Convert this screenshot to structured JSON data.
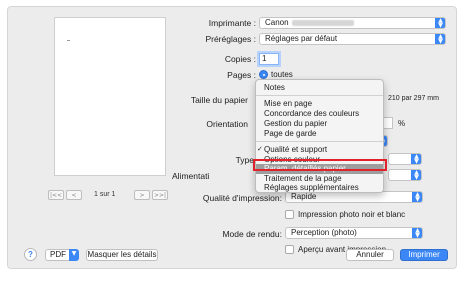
{
  "printer": {
    "label": "Imprimante :",
    "value": "Canon"
  },
  "presets": {
    "label": "Préréglages :",
    "value": "Réglages par défaut"
  },
  "copies": {
    "label": "Copies :",
    "value": "1"
  },
  "pages": {
    "label": "Pages :",
    "value": "toutes"
  },
  "paper_size": {
    "label": "Taille du papier",
    "dimensions": "210 par 297 mm"
  },
  "orientation": {
    "label": "Orientation",
    "percent": "%"
  },
  "type": {
    "label": "Type"
  },
  "feed": {
    "label": "Alimentati"
  },
  "quality": {
    "label": "Qualité d'impression:",
    "value": "Rapide"
  },
  "bw_photo": {
    "label": "Impression photo noir et blanc"
  },
  "render_mode": {
    "label": "Mode de rendu:",
    "value": "Perception (photo)"
  },
  "preview_check": {
    "label": "Aperçu avant impression"
  },
  "preview_nav": {
    "first": "|<<",
    "prev": "<",
    "page_indicator": "1 sur 1",
    "next": ">",
    "last": ">>|"
  },
  "menu": {
    "items": [
      {
        "label": "Notes"
      },
      {
        "label": "Mise en page"
      },
      {
        "label": "Concordance des couleurs"
      },
      {
        "label": "Gestion du papier"
      },
      {
        "label": "Page de garde"
      },
      {
        "label": "Qualité et support",
        "checked": true
      },
      {
        "label": "Options couleur"
      },
      {
        "label": "Param. détaillés papier",
        "selected": true
      },
      {
        "label": "Traitement de la page"
      },
      {
        "label": "Réglages supplémentaires"
      }
    ]
  },
  "footer": {
    "help": "?",
    "pdf": "PDF",
    "hide_details": "Masquer les détails",
    "cancel": "Annuler",
    "print": "Imprimer"
  },
  "colors": {
    "accent": "#3b87f5",
    "highlight": "#e0222b"
  }
}
